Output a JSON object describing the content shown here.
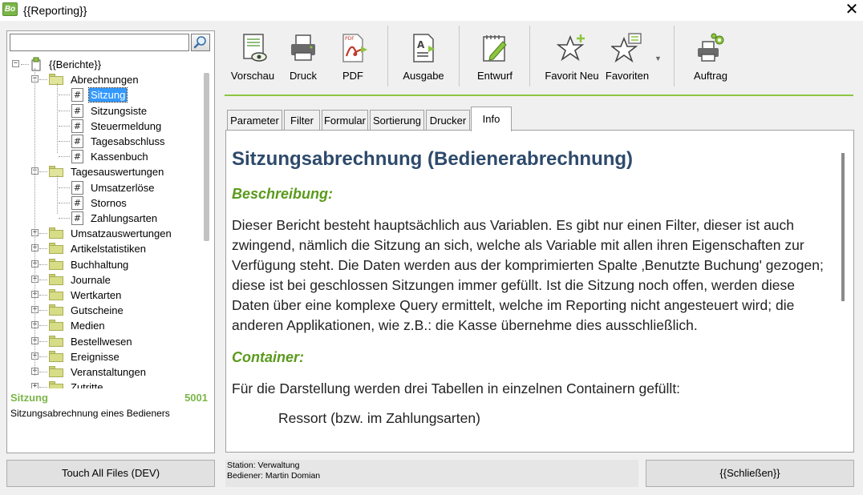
{
  "window": {
    "icon_text": "Bo",
    "title": "{{Reporting}}",
    "close_glyph": "✕"
  },
  "search": {
    "value": "",
    "placeholder": ""
  },
  "tree": {
    "root": "{{Berichte}}",
    "nodes": [
      {
        "label": "Abrechnungen",
        "type": "folder",
        "expanded": true
      },
      {
        "label": "Sitzung",
        "type": "report",
        "selected": true
      },
      {
        "label": "Sitzungsiste",
        "type": "report"
      },
      {
        "label": "Steuermeldung",
        "type": "report"
      },
      {
        "label": "Tagesabschluss",
        "type": "report"
      },
      {
        "label": "Kassenbuch",
        "type": "report"
      },
      {
        "label": "Tagesauswertungen",
        "type": "folder",
        "expanded": true
      },
      {
        "label": "Umsatzerlöse",
        "type": "report"
      },
      {
        "label": "Stornos",
        "type": "report"
      },
      {
        "label": "Zahlungsarten",
        "type": "report"
      },
      {
        "label": "Umsatzauswertungen",
        "type": "folder"
      },
      {
        "label": "Artikelstatistiken",
        "type": "folder"
      },
      {
        "label": "Buchhaltung",
        "type": "folder"
      },
      {
        "label": "Journale",
        "type": "folder"
      },
      {
        "label": "Wertkarten",
        "type": "folder"
      },
      {
        "label": "Gutscheine",
        "type": "folder"
      },
      {
        "label": "Medien",
        "type": "folder"
      },
      {
        "label": "Bestellwesen",
        "type": "folder"
      },
      {
        "label": "Ereignisse",
        "type": "folder"
      },
      {
        "label": "Veranstaltungen",
        "type": "folder"
      },
      {
        "label": "Zutritte",
        "type": "folder"
      }
    ],
    "report_icon_glyph": "#",
    "expander_collapsed": "+",
    "expander_expanded": "−"
  },
  "selection": {
    "name": "Sitzung",
    "number": "5001",
    "description": "Sitzungsabrechnung eines Bedieners"
  },
  "touch_button": "Touch All Files (DEV)",
  "toolbar": {
    "vorschau": "Vorschau",
    "druck": "Druck",
    "pdf": "PDF",
    "ausgabe": "Ausgabe",
    "entwurf": "Entwurf",
    "favorit_neu": "Favorit Neu",
    "favoriten": "Favoriten",
    "auftrag": "Auftrag",
    "dropdown_glyph": "▼"
  },
  "tabs": [
    "Parameter",
    "Filter",
    "Formular",
    "Sortierung",
    "Drucker",
    "Info"
  ],
  "info": {
    "title": "Sitzungsabrechnung (Bedienerabrechnung)",
    "beschreibung_heading": "Beschreibung:",
    "beschreibung_text": "Dieser Bericht besteht hauptsächlich aus Variablen. Es gibt nur einen Filter, dieser ist auch zwingend, nämlich die Sitzung an sich, welche als Variable mit allen ihren Eigenschaften zur Verfügung steht. Die Daten werden aus der komprimierten Spalte ‚Benutzte Buchung' gezogen; diese ist bei geschlossen Sitzungen immer gefüllt. Ist die Sitzung noch offen, werden diese Daten über eine komplexe Query ermittelt, welche im Reporting nicht angesteuert wird; die anderen Applikationen, wie z.B.: die Kasse übernehme dies ausschließlich.",
    "container_heading": "Container:",
    "container_text": "Für die Darstellung werden drei Tabellen in einzelnen Containern gefüllt:",
    "container_item": "Ressort (bzw. im Zahlungsarten)"
  },
  "status": {
    "station": "Station: Verwaltung",
    "bediener": "Bediener: Martin Domian"
  },
  "close_button": "{{Schließen}}",
  "colors": {
    "accent_green": "#8cc63f",
    "heading_green": "#5a9a1c",
    "title_blue": "#2e4a6b",
    "selection": "#3399ff"
  }
}
